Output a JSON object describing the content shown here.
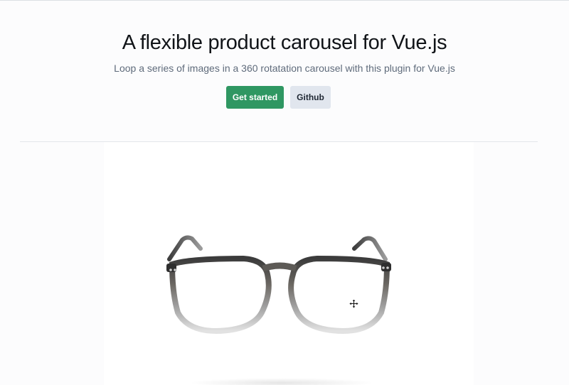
{
  "hero": {
    "title": "A flexible product carousel for Vue.js",
    "subtitle": "Loop a series of images in a 360 rotatation carousel with this plugin for Vue.js"
  },
  "actions": {
    "primary_label": "Get started",
    "secondary_label": "Github"
  },
  "colors": {
    "primary": "#2f9762",
    "secondary": "#e1e6ee",
    "title": "#111418",
    "subtitle": "#5f6b7b"
  },
  "carousel": {
    "product_icon": "eyeglasses-icon",
    "cursor_icon": "move-cursor-icon"
  }
}
